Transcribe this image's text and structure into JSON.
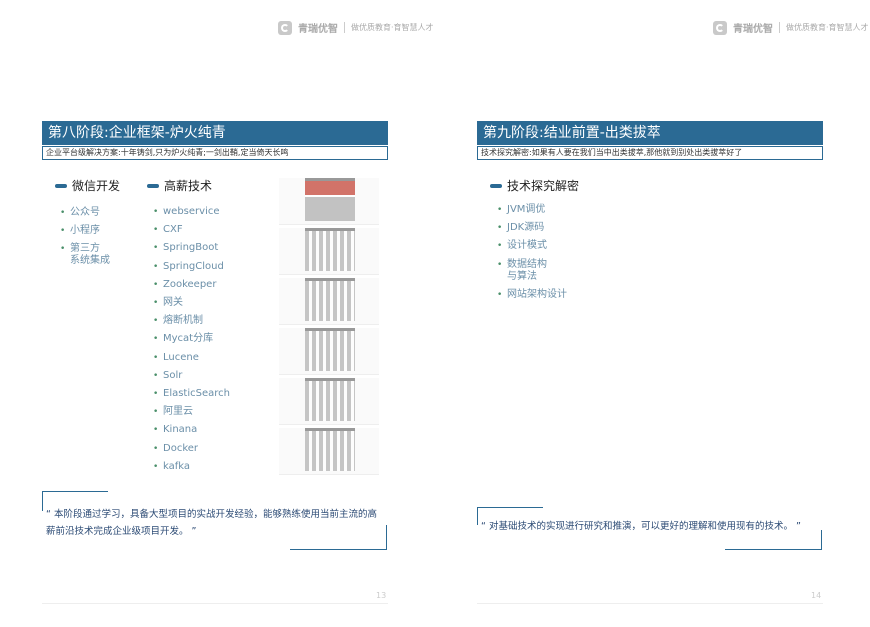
{
  "brand": {
    "name": "青瑞优智",
    "slogan": "做优质教育·育智慧人才"
  },
  "left": {
    "title": "第八阶段:企业框架-炉火纯青",
    "subtitle": "企业平台级解决方案:十年铸剑,只为炉火纯青;一剑出鞘,定当倚天长鸣",
    "col1": {
      "heading": "微信开发",
      "items": [
        "公众号",
        "小程序",
        "第三方\n系统集成"
      ]
    },
    "col2": {
      "heading": "高薪技术",
      "items": [
        "webservice",
        "CXF",
        "SpringBoot",
        "SpringCloud",
        "Zookeeper",
        "网关",
        "熔断机制",
        "Mycat分库",
        "Lucene",
        "Solr",
        "ElasticSearch",
        "阿里云",
        "Kinana",
        "Docker",
        "kafka"
      ]
    },
    "quote": "“ 本阶段通过学习，具备大型项目的实战开发经验，能够熟练使用当前主流的高薪前沿技术完成企业级项目开发。 ”",
    "page": "13"
  },
  "right": {
    "title": "第九阶段:结业前置-出类拔萃",
    "subtitle": "技术探究解密:如果有人要在我们当中出类拔萃,那他就到别处出类拔萃好了",
    "col1": {
      "heading": "技术探究解密",
      "items": [
        "JVM调优",
        "JDK源码",
        "设计模式",
        "数据结构\n与算法",
        "网站架构设计"
      ]
    },
    "quote": "“ 对基础技术的实现进行研究和推演，可以更好的理解和使用现有的技术。 ”",
    "page": "14"
  }
}
